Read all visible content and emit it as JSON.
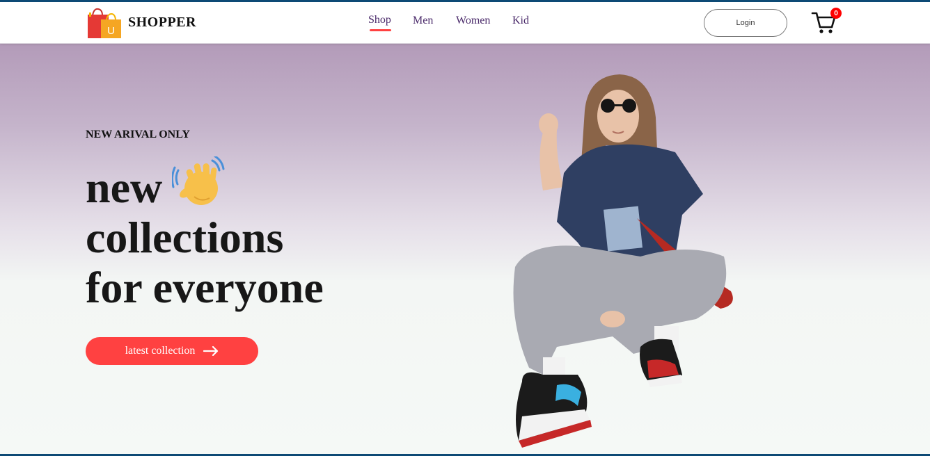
{
  "navbar": {
    "brand": "SHOPPER",
    "logo_icon": "shopping-bag-logo",
    "logo_letter": "U",
    "menu": [
      {
        "label": "Shop",
        "active": true
      },
      {
        "label": "Men",
        "active": false
      },
      {
        "label": "Women",
        "active": false
      },
      {
        "label": "Kid",
        "active": false
      }
    ],
    "login_label": "Login",
    "cart_icon": "cart-icon",
    "cart_count": "0"
  },
  "hero": {
    "kicker": "NEW ARIVAL ONLY",
    "headline": [
      "new",
      "collections",
      "for everyone"
    ],
    "wave_icon": "waving-hand-icon",
    "cta_label": "latest collection",
    "cta_icon": "arrow-right-icon",
    "image": "fashion-model-photo"
  },
  "colors": {
    "accent": "#ff4141",
    "menu_text": "#4a2a6a",
    "hero_top": "#b39bb9",
    "hero_bottom": "#f5f9f6",
    "badge": "#ff0000"
  }
}
